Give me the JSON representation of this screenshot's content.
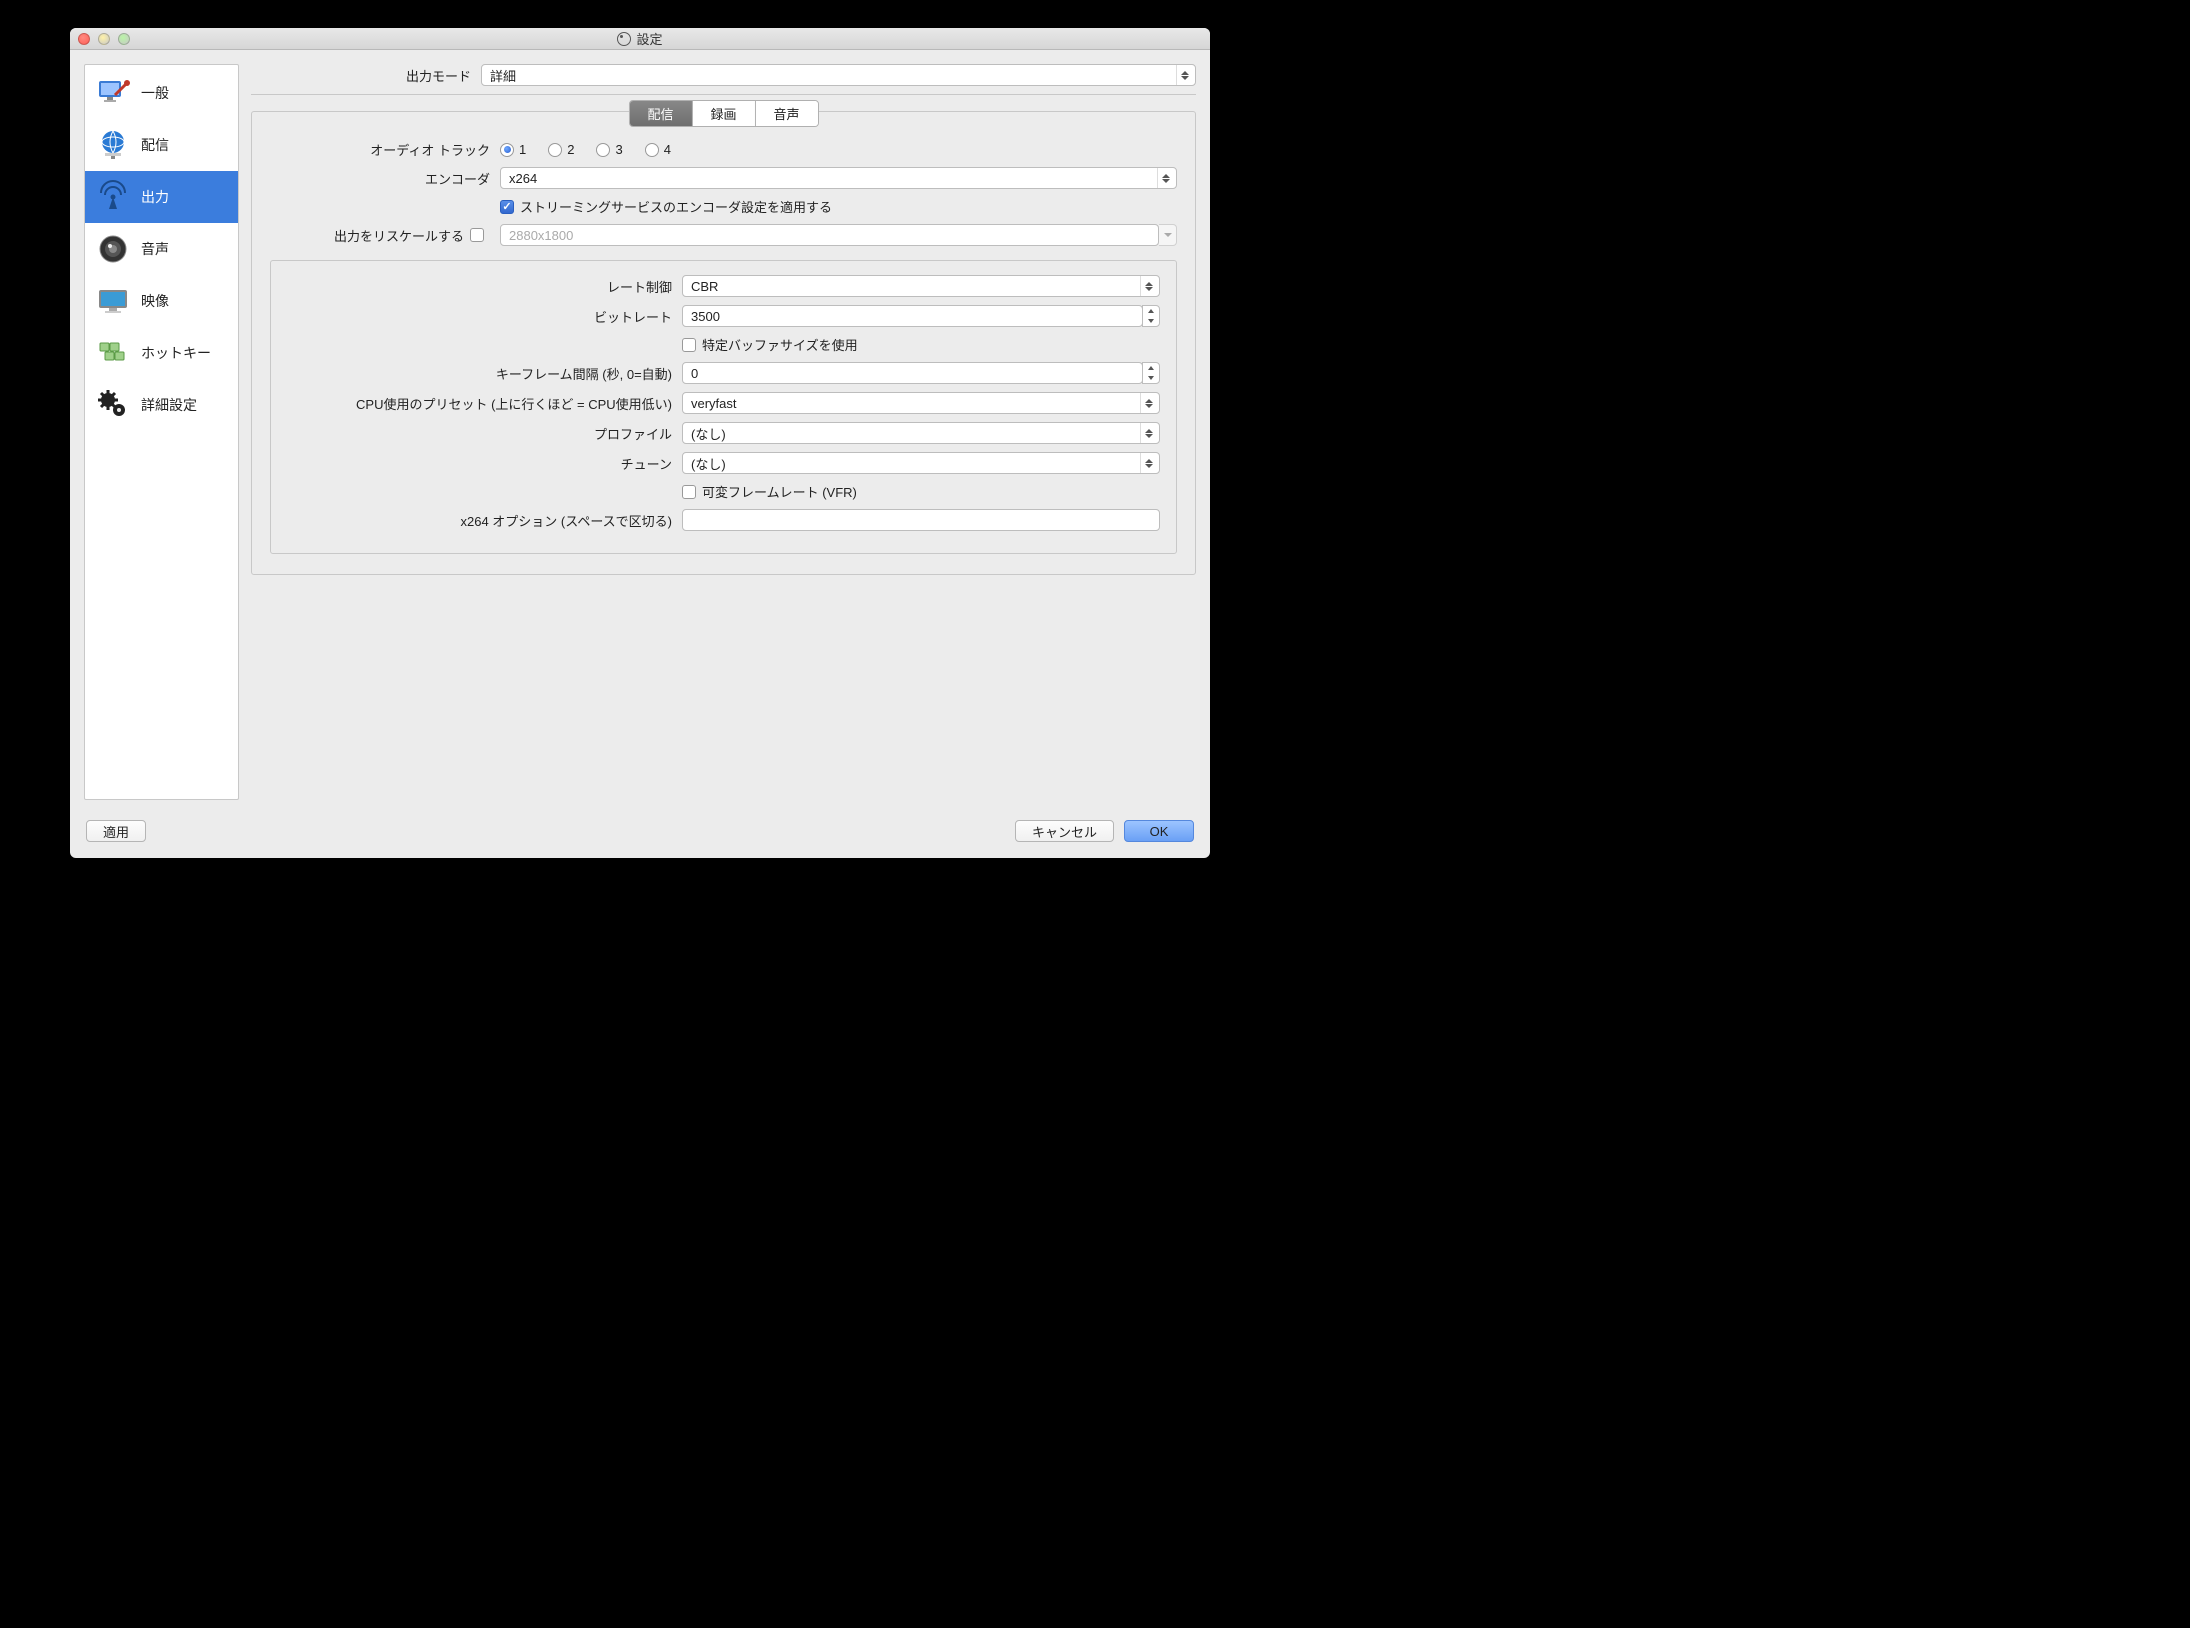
{
  "window": {
    "title": "設定"
  },
  "sidebar": {
    "items": [
      {
        "label": "一般"
      },
      {
        "label": "配信"
      },
      {
        "label": "出力"
      },
      {
        "label": "音声"
      },
      {
        "label": "映像"
      },
      {
        "label": "ホットキー"
      },
      {
        "label": "詳細設定"
      }
    ],
    "active_index": 2
  },
  "top": {
    "output_mode_label": "出力モード",
    "output_mode_value": "詳細"
  },
  "tabs": {
    "items": [
      "配信",
      "録画",
      "音声"
    ],
    "active_index": 0
  },
  "stream": {
    "audio_track_label": "オーディオ トラック",
    "audio_tracks": [
      "1",
      "2",
      "3",
      "4"
    ],
    "audio_track_selected": 0,
    "encoder_label": "エンコーダ",
    "encoder_value": "x264",
    "enforce_label": "ストリーミングサービスのエンコーダ設定を適用する",
    "enforce_checked": true,
    "rescale_label": "出力をリスケールする",
    "rescale_checked": false,
    "rescale_value": "2880x1800"
  },
  "encoder": {
    "rate_control_label": "レート制御",
    "rate_control_value": "CBR",
    "bitrate_label": "ビットレート",
    "bitrate_value": "3500",
    "custom_buffer_label": "特定バッファサイズを使用",
    "custom_buffer_checked": false,
    "keyint_label": "キーフレーム間隔 (秒, 0=自動)",
    "keyint_value": "0",
    "cpu_preset_label": "CPU使用のプリセット (上に行くほど = CPU使用低い)",
    "cpu_preset_value": "veryfast",
    "profile_label": "プロファイル",
    "profile_value": "(なし)",
    "tune_label": "チューン",
    "tune_value": "(なし)",
    "vfr_label": "可変フレームレート (VFR)",
    "vfr_checked": false,
    "x264opts_label": "x264 オプション (スペースで区切る)",
    "x264opts_value": ""
  },
  "footer": {
    "apply": "適用",
    "cancel": "キャンセル",
    "ok": "OK"
  }
}
